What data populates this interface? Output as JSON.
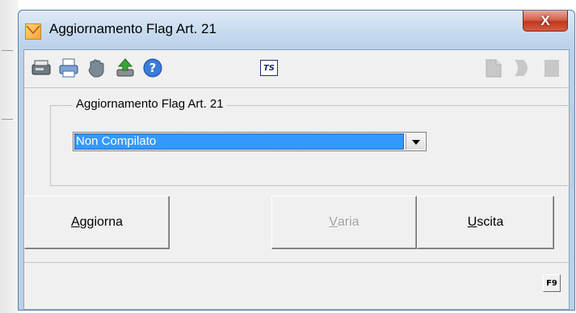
{
  "window": {
    "title": "Aggiornamento Flag Art. 21",
    "close_glyph": "X"
  },
  "toolbar": {
    "icons": [
      "printer-setup-icon",
      "printer-icon",
      "hand-icon",
      "upload-icon",
      "help-icon"
    ],
    "ts_label": "TS",
    "right_icons": [
      "document-icon",
      "arrow-icon",
      "page-icon"
    ]
  },
  "group": {
    "label": "Aggiornamento Flag Art. 21",
    "combo_value": "Non Compilato"
  },
  "buttons": {
    "update": {
      "mnemonic": "A",
      "rest": "ggiorna",
      "enabled": true
    },
    "edit": {
      "mnemonic": "V",
      "rest": "aria",
      "enabled": false
    },
    "exit": {
      "mnemonic": "U",
      "rest": "scita",
      "enabled": true
    }
  },
  "status": {
    "f9_label": "F9"
  },
  "colors": {
    "selection": "#3399ff",
    "window_frame": "#b9d1ea",
    "client_bg": "#f0f0f0",
    "close_red": "#c1391f"
  }
}
